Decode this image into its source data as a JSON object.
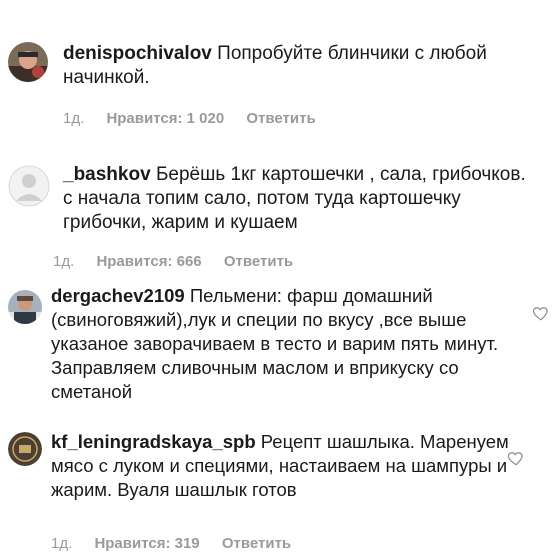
{
  "comments": [
    {
      "username": "denispochivalov",
      "text": "Попробуйте блинчики с любой начинкой.",
      "time": "1д.",
      "likes": "Нравится: 1 020",
      "reply": "Ответить",
      "avatar": "photo-avatar-person",
      "has_heart": false
    },
    {
      "username": "_bashkov",
      "text": "Берёшь 1кг картошечки , сала, грибочков. с начала топим сало, потом туда картошечку грибочки, жарим и кушаем",
      "time": "1д.",
      "likes": "Нравится: 666",
      "reply": "Ответить",
      "avatar": "default-avatar",
      "has_heart": false
    },
    {
      "username": "dergachev2109",
      "text": "Пельмени: фарш домашний (свиноговяжий),лук и специи по вкусу ,все выше указаное заворачиваем в тесто и варим пять минут. Заправляем сливочным маслом и вприкуску со сметаной",
      "avatar": "photo-avatar-person",
      "has_heart": true
    },
    {
      "username": "kf_leningradskaya_spb",
      "text": "Рецепт шашлыка. Маренуем мясо с луком и  специями, настаиваем на шампуры  и жарим. Вуаля шашлык готов",
      "time": "1д.",
      "likes": "Нравится: 319",
      "reply": "Ответить",
      "avatar": "logo-avatar",
      "has_heart": true
    }
  ],
  "icons": {
    "heart": "heart-outline-icon"
  },
  "colors": {
    "text": "#1a1a1a",
    "meta": "#9a9a9a",
    "heart": "#8e8e8e"
  }
}
